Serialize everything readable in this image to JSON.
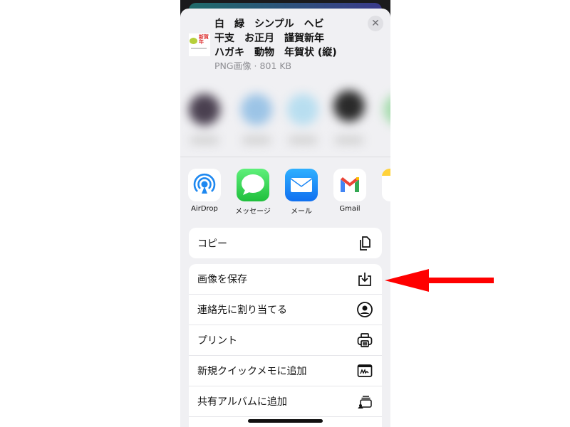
{
  "share_sheet": {
    "title_lines": [
      "白　緑　シンプル　ヘビ",
      "干支　お正月　謹賀新年",
      "ハガキ　動物　年賀状 (縦)"
    ],
    "subtitle": "PNG画像 · 801 KB",
    "close_label": "✕",
    "apps": [
      {
        "label": "AirDrop",
        "icon": "airdrop-icon"
      },
      {
        "label": "メッセージ",
        "icon": "messages-icon"
      },
      {
        "label": "メール",
        "icon": "mail-icon"
      },
      {
        "label": "Gmail",
        "icon": "gmail-icon"
      },
      {
        "label": "",
        "icon": "notes-icon"
      }
    ],
    "copy_action": {
      "label": "コピー",
      "icon": "copy-icon"
    },
    "actions": [
      {
        "label": "画像を保存",
        "icon": "save-download-icon"
      },
      {
        "label": "連絡先に割り当てる",
        "icon": "contact-icon"
      },
      {
        "label": "プリント",
        "icon": "printer-icon"
      },
      {
        "label": "新規クイックメモに追加",
        "icon": "quick-note-icon"
      },
      {
        "label": "共有アルバムに追加",
        "icon": "shared-album-icon"
      }
    ]
  },
  "annotation": {
    "arrow_color": "#ff0000",
    "points_to": "画像を保存"
  }
}
